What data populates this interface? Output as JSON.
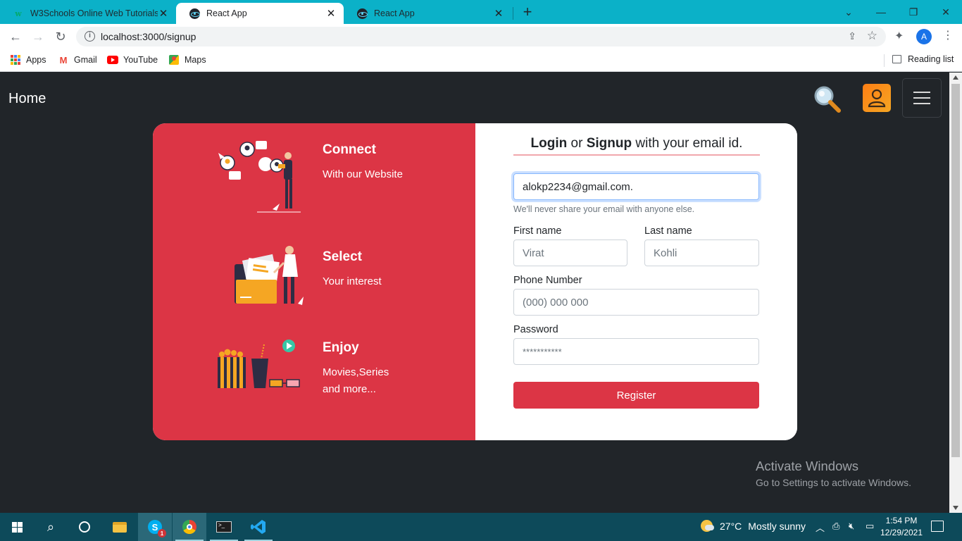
{
  "browser": {
    "tabs": [
      {
        "title": "W3Schools Online Web Tutorials",
        "icon": "w3schools-icon",
        "active": false
      },
      {
        "title": "React App",
        "icon": "react-icon",
        "active": true
      },
      {
        "title": "React App",
        "icon": "react-icon",
        "active": false
      }
    ],
    "url": "localhost:3000/signup",
    "profile_initial": "A",
    "bookmarks": [
      {
        "label": "Apps",
        "icon": "apps-grid-icon"
      },
      {
        "label": "Gmail",
        "icon": "gmail-icon"
      },
      {
        "label": "YouTube",
        "icon": "youtube-icon"
      },
      {
        "label": "Maps",
        "icon": "maps-icon"
      }
    ],
    "reading_list": "Reading list"
  },
  "navbar": {
    "brand": "Home"
  },
  "features": [
    {
      "title": "Connect",
      "subtitle": "With our Website"
    },
    {
      "title": "Select",
      "subtitle": "Your interest"
    },
    {
      "title": "Enjoy",
      "subtitle_line1": "Movies,Series",
      "subtitle_line2": "and more..."
    }
  ],
  "form": {
    "heading_bold1": "Login",
    "heading_mid": " or ",
    "heading_bold2": "Signup",
    "heading_rest": " with your email id.",
    "email_value": "alokp2234@gmail.com.",
    "email_help": "We'll never share your email with anyone else.",
    "first_name_label": "First name",
    "first_name_placeholder": "Virat",
    "last_name_label": "Last name",
    "last_name_placeholder": "Kohli",
    "phone_label": "Phone Number",
    "phone_placeholder": "(000) 000 000",
    "password_label": "Password",
    "password_placeholder": "***********",
    "register_label": "Register"
  },
  "watermark": {
    "line1": "Activate Windows",
    "line2": "Go to Settings to activate Windows."
  },
  "taskbar": {
    "weather_temp": "27°C",
    "weather_text": "Mostly sunny",
    "time": "1:54 PM",
    "date": "12/29/2021",
    "skype_badge": "1"
  },
  "colors": {
    "accent_red": "#dc3545",
    "page_bg": "#212529",
    "tabstrip": "#0bb1c8",
    "taskbar": "#0d4a5a"
  }
}
